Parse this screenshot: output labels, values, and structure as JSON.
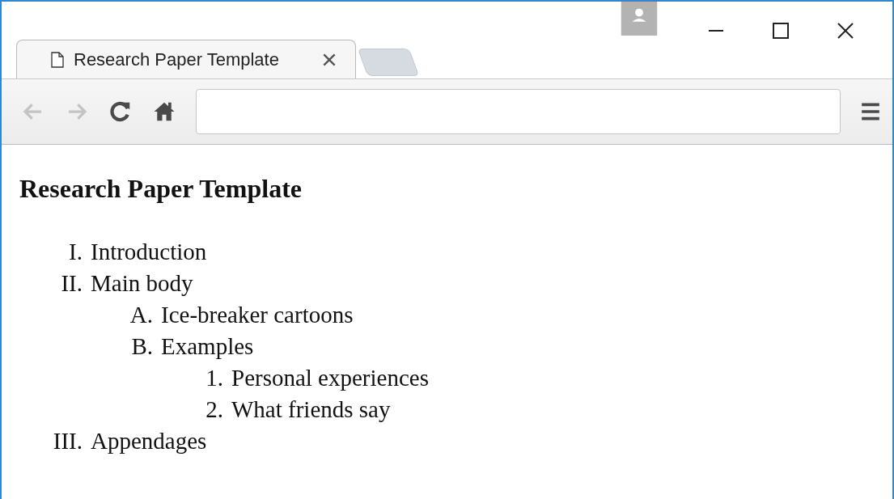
{
  "tabs": [
    {
      "title": "Research Paper Template",
      "selected": true
    }
  ],
  "toolbar": {
    "buttons": [
      {
        "kind": "back",
        "disabled": true
      },
      {
        "kind": "forward",
        "disabled": true
      },
      {
        "kind": "reload",
        "disabled": false
      },
      {
        "kind": "home",
        "disabled": false
      }
    ]
  },
  "page": {
    "heading": "Research Paper Template",
    "outline": [
      {
        "marker": "I.",
        "text": "Introduction"
      },
      {
        "marker": "II.",
        "text": "Main body",
        "children": [
          {
            "marker": "A.",
            "text": "Ice-breaker cartoons"
          },
          {
            "marker": "B.",
            "text": "Examples",
            "children": [
              {
                "marker": "1.",
                "text": "Personal experiences"
              },
              {
                "marker": "2.",
                "text": "What friends say"
              }
            ]
          }
        ]
      },
      {
        "marker": "III.",
        "text": "Appendages"
      }
    ]
  }
}
